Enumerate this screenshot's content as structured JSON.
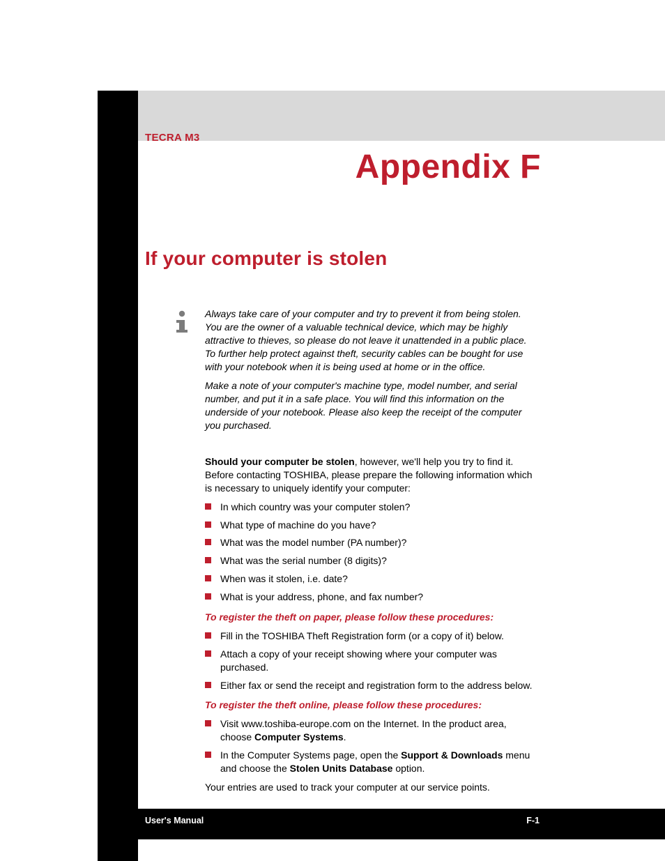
{
  "product": "TECRA M3",
  "appendix": "Appendix F",
  "section_title": "If your computer is stolen",
  "info": {
    "p1": "Always take care of your computer and try to prevent it from being stolen. You are the owner of a valuable technical device, which may be highly attractive to thieves, so please do not leave it unattended in a public place. To further help protect against theft, security cables can be bought for use with your notebook when it is being used at home or in the office.",
    "p2": "Make a note of your computer's machine type, model number, and serial number, and put it in a safe place. You will find this information on the underside of your notebook. Please also keep the receipt of the computer you purchased."
  },
  "intro": {
    "lead_bold": "Should your computer be stolen",
    "lead_rest": ", however, we'll help you try to find it. Before contacting TOSHIBA, please prepare the following information which is necessary to uniquely identify your computer:"
  },
  "questions": [
    "In which country was your computer stolen?",
    "What type of machine do you have?",
    "What was the model number (PA number)?",
    "What was the serial number (8 digits)?",
    "When was it stolen, i.e. date?",
    "What is your address, phone, and fax number?"
  ],
  "paper_head": "To register the theft on paper, please follow these procedures:",
  "paper_steps": [
    "Fill in the TOSHIBA Theft Registration form (or a copy of it) below.",
    "Attach a copy of your receipt showing where your computer was purchased.",
    "Either fax or send the receipt and registration form to the address below."
  ],
  "online_head": "To register the theft online, please follow these procedures:",
  "online_steps": {
    "s1a": "Visit www.toshiba-europe.com on the Internet. In the product area, choose ",
    "s1b": "Computer Systems",
    "s1c": ".",
    "s2a": "In the Computer Systems page, open the ",
    "s2b": "Support & Downloads",
    "s2c": " menu and choose the ",
    "s2d": "Stolen Units Database",
    "s2e": " option."
  },
  "closing": "Your entries are used to track your computer at our service points.",
  "footer": {
    "left": "User's Manual",
    "right": "F-1"
  }
}
